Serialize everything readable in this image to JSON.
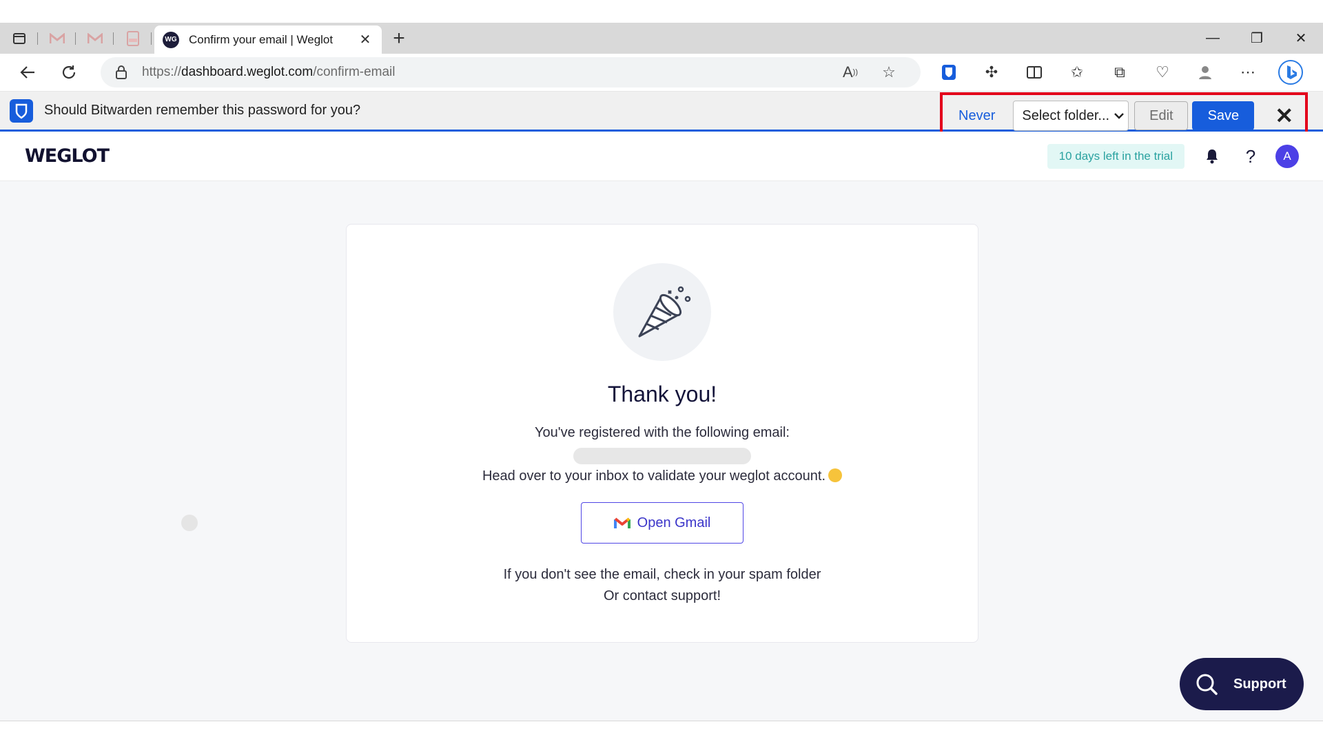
{
  "browser": {
    "tabs": [
      {
        "name": "tab-sidebar-toggle"
      },
      {
        "name": "tab-gmail-1"
      },
      {
        "name": "tab-gmail-2"
      },
      {
        "name": "tab-pdf"
      }
    ],
    "active_tab": {
      "favicon": "WG",
      "title": "Confirm your email | Weglot",
      "close": "✕"
    },
    "new_tab": "+",
    "window_controls": {
      "minimize": "—",
      "restore": "❐",
      "close": "✕"
    },
    "url": {
      "scheme": "https://",
      "host": "dashboard.weglot.com",
      "path": "/confirm-email"
    }
  },
  "bitwarden": {
    "message": "Should Bitwarden remember this password for you?",
    "never_label": "Never",
    "folder_select": "Select folder...",
    "edit_label": "Edit",
    "save_label": "Save",
    "close": "✕",
    "accent": "#175ddc"
  },
  "weglot": {
    "logo": "WEGLOT",
    "trial_badge": "10 days left in the trial",
    "avatar_initial": "A",
    "help": "?",
    "card": {
      "title": "Thank you!",
      "registered_text": "You've registered with the following email:",
      "head_over_text": "Head over to your inbox to validate your weglot account.",
      "gmail_button": "Open Gmail",
      "spam_text": "If you don't see the email, check in your spam folder",
      "contact_text": "Or contact support!"
    },
    "support_button": "Support",
    "brand_color": "#1b1b4b"
  }
}
